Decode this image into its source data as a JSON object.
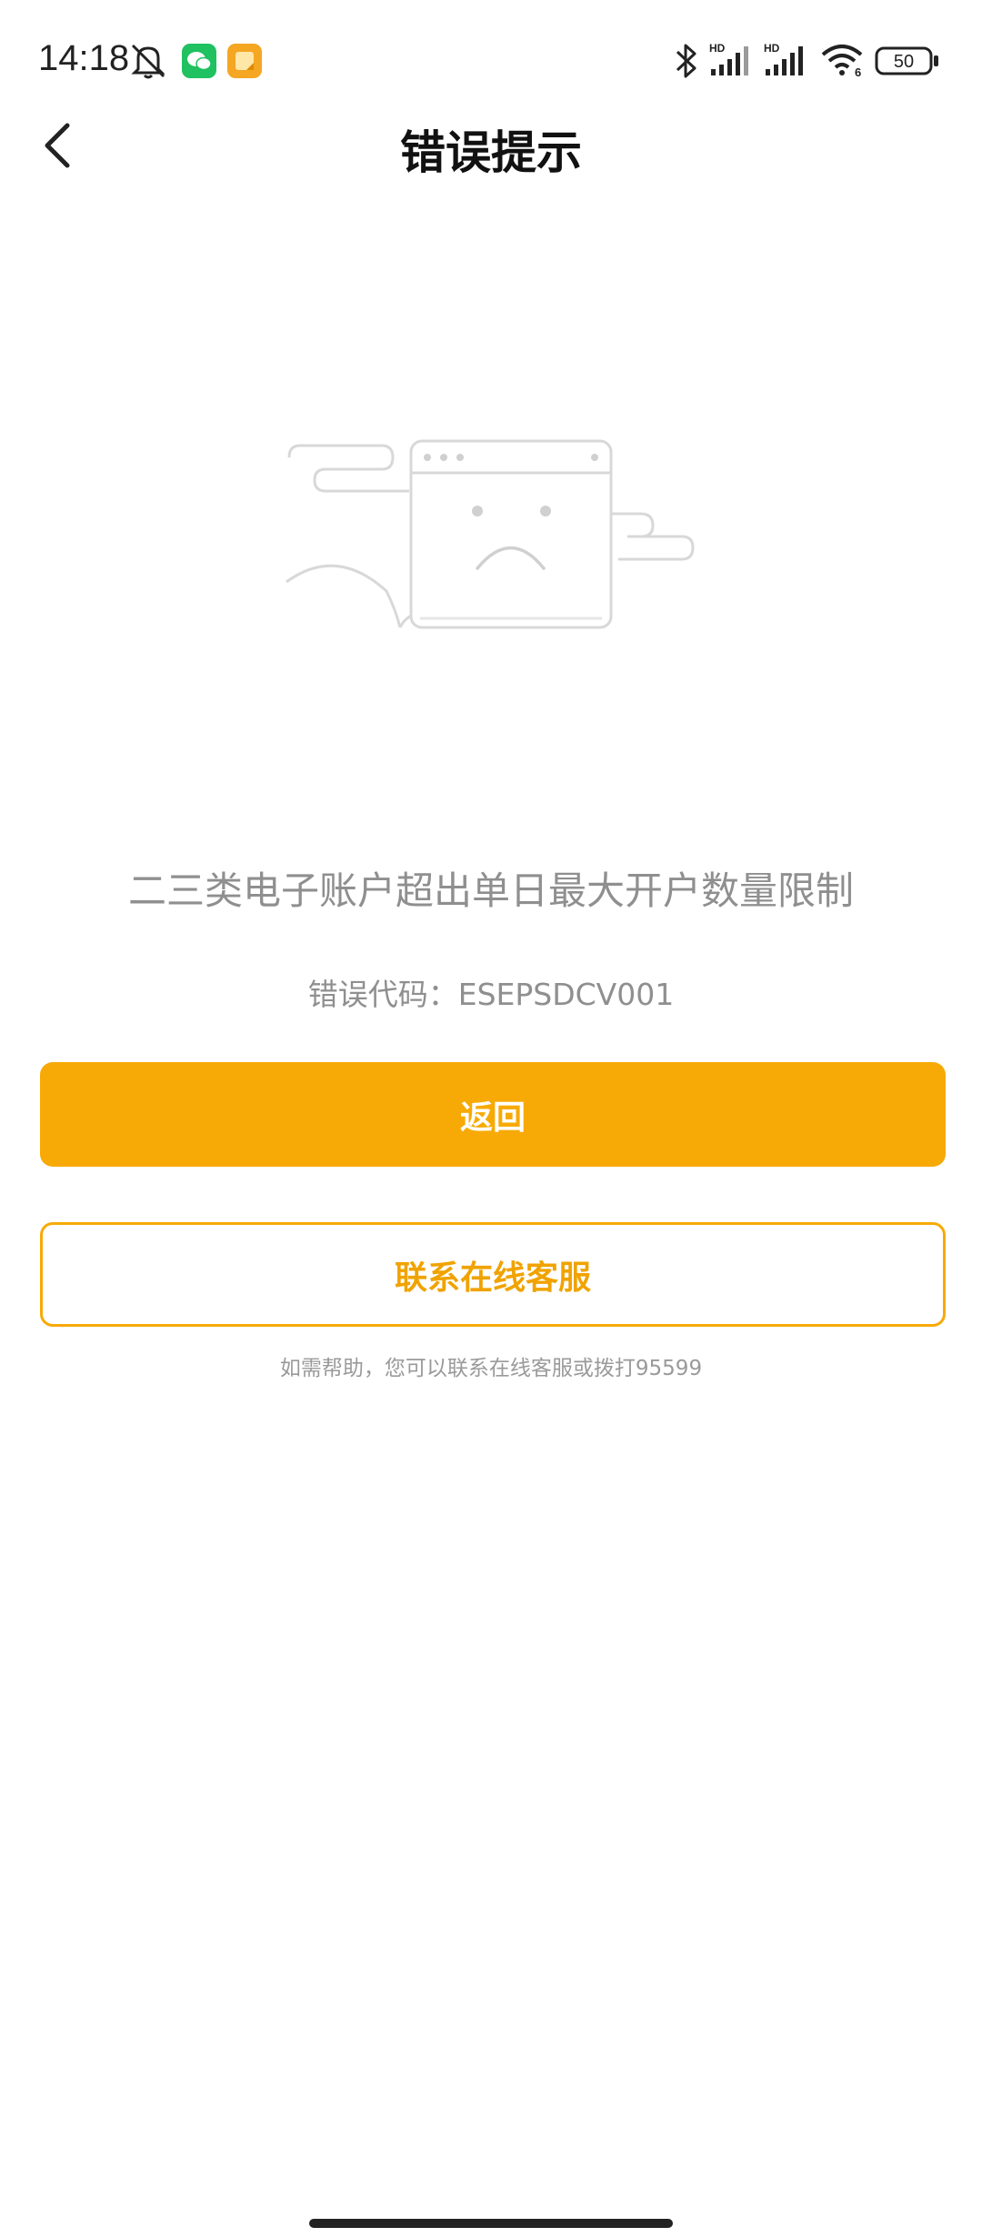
{
  "status_bar": {
    "time": "14:18",
    "battery": "50",
    "icons": [
      "mute-bell-icon",
      "wechat-icon",
      "notes-app-icon",
      "bluetooth-icon",
      "signal-hd-icon",
      "signal-hd-icon",
      "wifi-6-icon",
      "battery-icon"
    ],
    "hd_label": "HD",
    "wifi_label": "6"
  },
  "header": {
    "title": "错误提示",
    "back_icon": "chevron-left-icon"
  },
  "content": {
    "message": "二三类电子账户超出单日最大开户数量限制",
    "error_code": "错误代码：ESEPSDCV001",
    "illustration_icon": "sad-browser-window-icon"
  },
  "actions": {
    "back_label": "返回",
    "contact_label": "联系在线客服"
  },
  "help": {
    "text": "如需帮助，您可以联系在线客服或拨打95599"
  },
  "colors": {
    "accent": "#f7aa06",
    "text_gray": "#8f8f8f",
    "wechat_green": "#1aad19",
    "notes_orange": "#f5a623"
  }
}
